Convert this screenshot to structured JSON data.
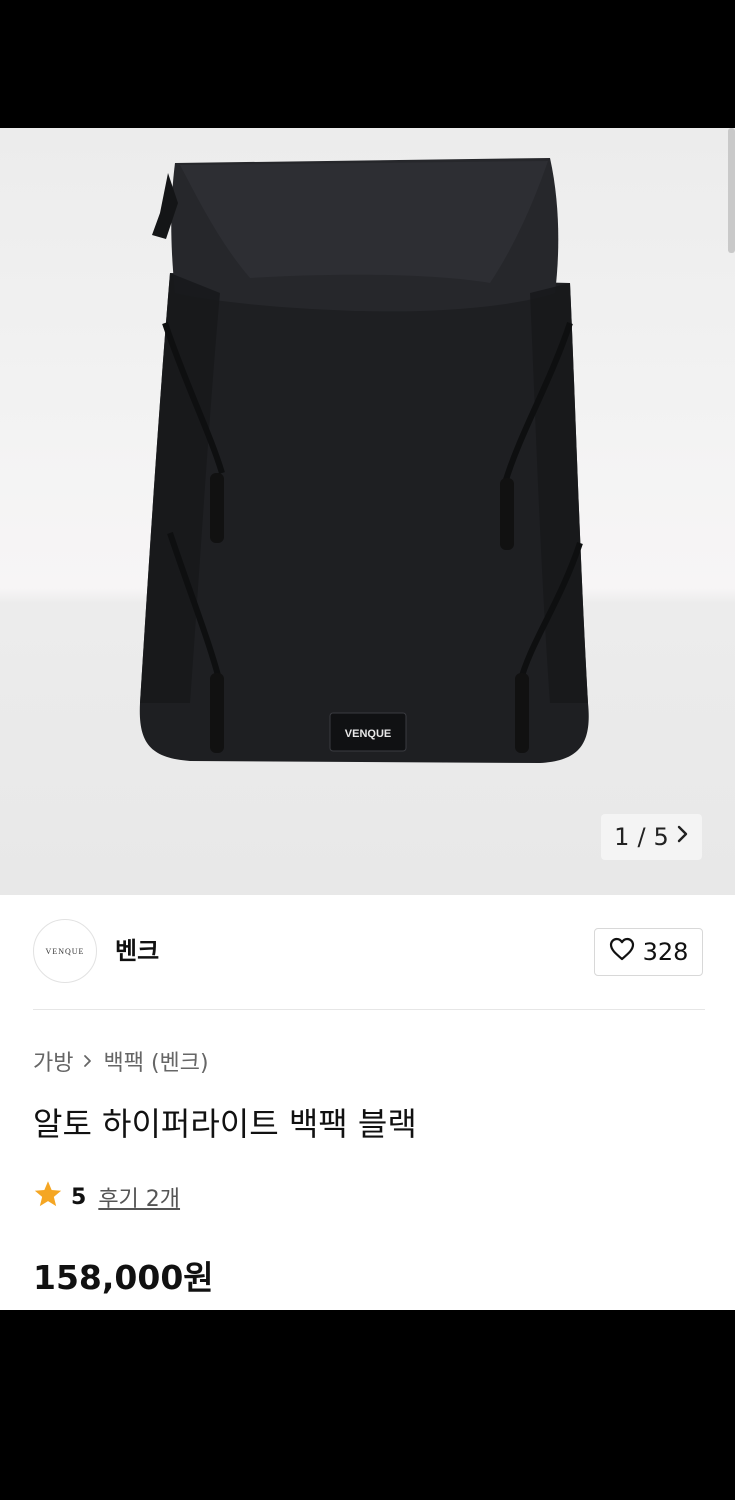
{
  "gallery": {
    "counter": {
      "current": "1",
      "separator": "/",
      "total": "5"
    },
    "product_logo": "VENQUE"
  },
  "seller": {
    "avatar_text": "VENQUE",
    "name": "벤크",
    "like_count": "328"
  },
  "breadcrumb": {
    "category": "가방",
    "subcategory": "백팩 (벤크)"
  },
  "product": {
    "title": "알토 하이퍼라이트 백팩 블랙",
    "rating": "5",
    "reviews_label": "후기 2개",
    "price": "158,000원"
  },
  "colors": {
    "star": "#f5a623",
    "text": "#111111",
    "muted": "#666666"
  },
  "icons": {
    "next": "chevron-right-icon",
    "like": "heart-outline-icon",
    "rating": "star-icon",
    "breadcrumb_sep": "chevron-right-icon"
  }
}
